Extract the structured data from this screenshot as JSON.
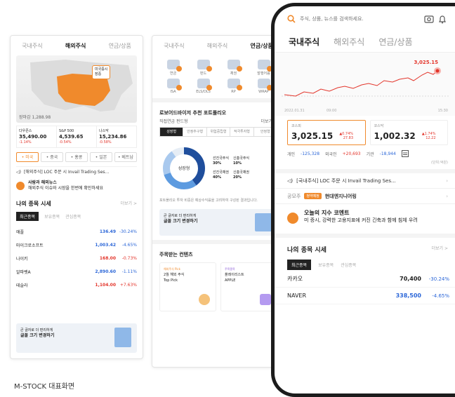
{
  "caption": "M-STOCK 대표화면",
  "p1": {
    "tabs": [
      "국내주식",
      "해외주식",
      "연금/상품"
    ],
    "active_tab": 1,
    "map_date": "장마감 1,288.98",
    "map_pin": [
      "미국증시",
      "장중"
    ],
    "indices": [
      {
        "name": "다우존스",
        "value": "35,490.00",
        "change": "-1.14%"
      },
      {
        "name": "S&P 500",
        "value": "4,539.65",
        "change": "-0.54%"
      },
      {
        "name": "나스닥",
        "value": "15,234.86",
        "change": "-0.58%"
      }
    ],
    "chips": [
      "• 미국",
      "• 중국",
      "• 홍콩",
      "• 일본",
      "• 베트남"
    ],
    "news": "[해외주식] LOC 주문 시 Invail Trading Ses...",
    "comment_title": "사람과 해외뉴스",
    "comment_body": "해외주식 이슈와 시장을 한번에 확인하세요",
    "section_title": "나의 종목 시세",
    "section_more": "더보기 >",
    "subtabs": [
      "최근종목",
      "보유종목",
      "관심종목"
    ],
    "stocks": [
      {
        "name": "애플",
        "price": "136.49",
        "rate": "-30.24%",
        "dir": "dn"
      },
      {
        "name": "마이크로소프트",
        "price": "1,003.42",
        "rate": "-4.65%",
        "dir": "dn"
      },
      {
        "name": "나이키",
        "price": "168.00",
        "rate": "-0.73%",
        "dir": "up"
      },
      {
        "name": "알파벳A",
        "price": "2,890.60",
        "rate": "-1.11%",
        "dir": "dn"
      },
      {
        "name": "테슬라",
        "price": "1,104.00",
        "rate": "+7.63%",
        "dir": "up"
      }
    ],
    "banner_small": "큰 글자로 더 편리하게",
    "banner_bold": "글꼴 크기 변경하기"
  },
  "p2": {
    "tabs": [
      "국내주식",
      "해외주식",
      "연금/상품"
    ],
    "active_tab": 2,
    "icons": [
      "연금",
      "펀드",
      "채권",
      "발행어음",
      "ISA",
      "ELS/DLS",
      "RP",
      "WRAP"
    ],
    "title": "로보어드바이저 추천 포트폴리오",
    "subtitle": "직접연금 펀드형",
    "subtitle_more": "더보기 >",
    "ptabs": [
      "성장형",
      "안정추구형",
      "위험중립형",
      "적극투자형",
      "안정형"
    ],
    "active_ptab": 0,
    "donut_label": "성장형",
    "legend": [
      {
        "name": "선진국주식",
        "value": "30%"
      },
      {
        "name": "신흥국주식",
        "value": "10%"
      },
      {
        "name": "선진국채권",
        "value": "40%"
      },
      {
        "name": "신흥국채권",
        "value": "20%"
      }
    ],
    "desc": "포트폴리오 투자 비중은 예상수익률을 고려하여 구성된 결과입니다.",
    "banner_small": "큰 글자로 더 편리하게",
    "banner_bold": "글꼴 크기 변경하기",
    "contents_title": "주목받는 컨텐츠",
    "cards": [
      {
        "tag": "해외주식 Pick",
        "line1": "2월 해외 주식",
        "line2": "Top Pick"
      },
      {
        "tag": "주목종목",
        "line1": "플레이리스트",
        "line2": "APPLE"
      }
    ]
  },
  "phone": {
    "search_placeholder": "주식, 상품, 뉴스를 검색하세요.",
    "tabs": [
      "국내주식",
      "해외주식",
      "연금/상품"
    ],
    "active_tab": 0,
    "chart_high": "3,025.15",
    "chart_date_left": "2022.01.31",
    "chart_time_mid": "09:00",
    "chart_time_right": "15:30",
    "indices": [
      {
        "name": "코스피",
        "value": "3,025.15",
        "chg1": "▲0.74%",
        "chg2": "27.83"
      },
      {
        "name": "코스닥",
        "value": "1,002.32",
        "chg1": "▲1.74%",
        "chg2": "12.22"
      }
    ],
    "flows": {
      "personal_label": "개인",
      "personal": "-125,328",
      "foreign_label": "외국인",
      "foreign": "+20,693",
      "inst_label": "기관",
      "inst": "-18,944",
      "unit": "(단위:억원)"
    },
    "news": "[국내주식] LOC 주문 시 Invail Trading Ses...",
    "ipo_label": "공모주",
    "ipo_badge": "청약예정",
    "ipo_name": "현대엔지니어링",
    "comment_title": "오늘의 지수 코멘트",
    "comment_body": "미 증시, 강력한 고용지표에 커진 긴축과 함께 침체 우려",
    "section_title": "나의 종목 시세",
    "section_more": "더보기 >",
    "subtabs": [
      "최근종목",
      "보유종목",
      "관심종목"
    ],
    "stocks": [
      {
        "name": "카카오",
        "price": "70,400",
        "rate": "-30.24%",
        "pdir": "",
        "dir": "dn"
      },
      {
        "name": "NAVER",
        "price": "338,500",
        "rate": "-4.65%",
        "pdir": "dn",
        "dir": "dn"
      }
    ]
  }
}
